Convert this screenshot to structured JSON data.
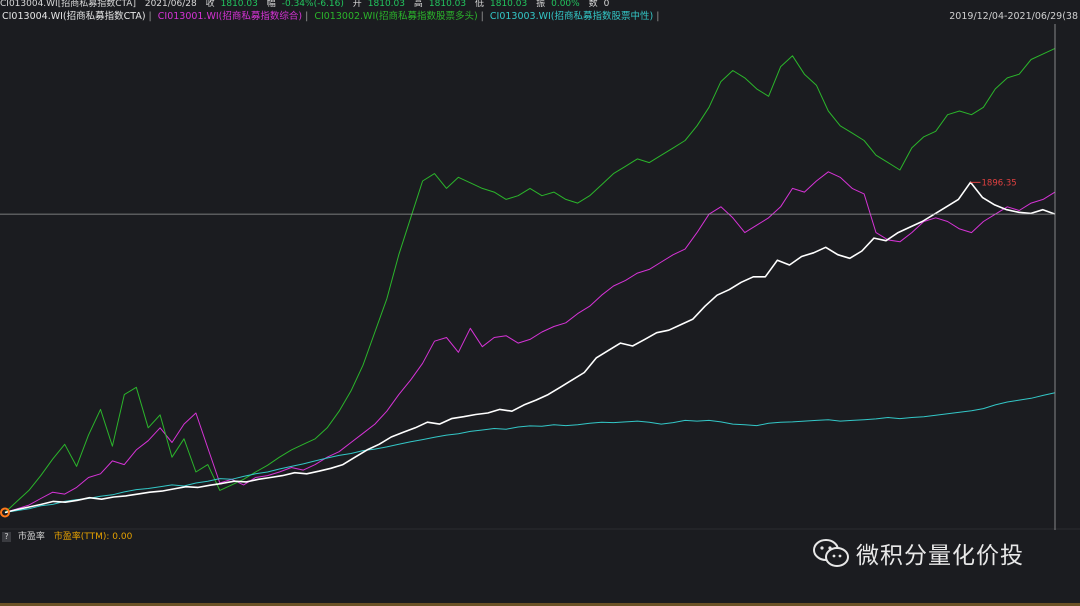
{
  "header": {
    "code": "CI013004.WI[招商私募指数CTA]",
    "date": "2021/06/28",
    "close_label": "收",
    "close": "1810.03",
    "change_label": "幅",
    "change": "-0.34%(-6.16)",
    "open_label": "开",
    "open": "1810.03",
    "high_label": "高",
    "high": "1810.03",
    "low_label": "低",
    "low": "1810.03",
    "amp_label": "振",
    "amp": "0.00%",
    "vol_label": "数",
    "vol": "0"
  },
  "legend": {
    "items": [
      {
        "label": "CI013004.WI(招商私募指数CTA)",
        "color": "#e6e6e6"
      },
      {
        "label": "CI013001.WI(招商私募指数综合)",
        "color": "#d633d6"
      },
      {
        "label": "CI013002.WI(招商私募指数股票多头)",
        "color": "#2bb52b"
      },
      {
        "label": "CI013003.WI(招商私募指数股票中性)",
        "color": "#33c7c7"
      }
    ]
  },
  "date_range": "2019/12/04-2021/06/29(38",
  "subpanel": {
    "question": "?",
    "name": "市盈率",
    "value": "市盈率(TTM): 0.00"
  },
  "watermark": "微积分量化价投",
  "chart_data": {
    "type": "line",
    "x_start": "2019/12/04",
    "x_end": "2021/06/29",
    "max_marker_label": "1896.35",
    "series": [
      {
        "name": "CI013004.WI(招商私募指数CTA)",
        "color": "#ffffff",
        "values": [
          1000,
          1008,
          1015,
          1022,
          1030,
          1028,
          1033,
          1040,
          1036,
          1042,
          1045,
          1050,
          1055,
          1058,
          1064,
          1070,
          1068,
          1074,
          1079,
          1085,
          1083,
          1090,
          1095,
          1100,
          1108,
          1105,
          1112,
          1120,
          1130,
          1150,
          1170,
          1185,
          1205,
          1218,
          1230,
          1245,
          1240,
          1255,
          1260,
          1266,
          1270,
          1280,
          1275,
          1292,
          1305,
          1320,
          1340,
          1360,
          1380,
          1420,
          1440,
          1460,
          1452,
          1470,
          1488,
          1495,
          1510,
          1525,
          1560,
          1590,
          1605,
          1625,
          1640,
          1640,
          1685,
          1672,
          1695,
          1705,
          1720,
          1700,
          1690,
          1710,
          1745,
          1738,
          1760,
          1775,
          1790,
          1810,
          1830,
          1850,
          1896.35,
          1855,
          1835,
          1822,
          1815,
          1812,
          1822,
          1810.03
        ]
      },
      {
        "name": "CI013001.WI(招商私募指数综合)",
        "color": "#d633d6",
        "values": [
          1000,
          1010,
          1020,
          1038,
          1055,
          1050,
          1068,
          1095,
          1105,
          1140,
          1130,
          1170,
          1195,
          1230,
          1190,
          1240,
          1270,
          1175,
          1080,
          1090,
          1075,
          1095,
          1100,
          1110,
          1122,
          1115,
          1130,
          1150,
          1165,
          1190,
          1215,
          1240,
          1275,
          1320,
          1360,
          1405,
          1465,
          1475,
          1435,
          1500,
          1450,
          1475,
          1480,
          1460,
          1470,
          1490,
          1505,
          1515,
          1540,
          1560,
          1590,
          1615,
          1630,
          1650,
          1660,
          1680,
          1700,
          1715,
          1760,
          1810,
          1830,
          1800,
          1760,
          1780,
          1800,
          1830,
          1880,
          1870,
          1900,
          1925,
          1910,
          1880,
          1865,
          1760,
          1740,
          1735,
          1760,
          1790,
          1800,
          1790,
          1770,
          1760,
          1790,
          1810,
          1830,
          1820,
          1840,
          1850,
          1870
        ]
      },
      {
        "name": "CI013002.WI(招商私募指数股票多头)",
        "color": "#2bb52b",
        "values": [
          1000,
          1030,
          1060,
          1100,
          1145,
          1185,
          1125,
          1210,
          1280,
          1180,
          1320,
          1340,
          1230,
          1265,
          1150,
          1200,
          1110,
          1130,
          1060,
          1075,
          1090,
          1110,
          1128,
          1150,
          1170,
          1185,
          1200,
          1230,
          1275,
          1330,
          1400,
          1490,
          1580,
          1700,
          1800,
          1900,
          1920,
          1880,
          1910,
          1895,
          1880,
          1870,
          1850,
          1860,
          1880,
          1860,
          1870,
          1850,
          1840,
          1860,
          1890,
          1920,
          1940,
          1960,
          1950,
          1970,
          1990,
          2010,
          2050,
          2100,
          2170,
          2200,
          2180,
          2150,
          2130,
          2210,
          2240,
          2190,
          2160,
          2090,
          2050,
          2030,
          2010,
          1970,
          1950,
          1930,
          1990,
          2020,
          2035,
          2080,
          2090,
          2080,
          2100,
          2150,
          2180,
          2190,
          2230,
          2245,
          2260
        ]
      },
      {
        "name": "CI013003.WI(招商私募指数股票中性)",
        "color": "#33c7c7",
        "values": [
          1000,
          1005,
          1010,
          1018,
          1022,
          1030,
          1035,
          1038,
          1044,
          1048,
          1056,
          1062,
          1065,
          1070,
          1075,
          1072,
          1080,
          1085,
          1092,
          1090,
          1098,
          1105,
          1110,
          1118,
          1125,
          1132,
          1140,
          1148,
          1155,
          1160,
          1168,
          1172,
          1178,
          1185,
          1192,
          1198,
          1204,
          1210,
          1214,
          1220,
          1224,
          1228,
          1226,
          1232,
          1235,
          1234,
          1238,
          1236,
          1238,
          1242,
          1245,
          1244,
          1246,
          1248,
          1245,
          1240,
          1244,
          1250,
          1248,
          1250,
          1246,
          1240,
          1238,
          1236,
          1242,
          1245,
          1246,
          1248,
          1250,
          1252,
          1248,
          1250,
          1252,
          1254,
          1258,
          1255,
          1258,
          1260,
          1264,
          1268,
          1272,
          1276,
          1282,
          1292,
          1300,
          1305,
          1310,
          1318,
          1325
        ]
      }
    ],
    "ylim": [
      985,
      2310
    ],
    "grid": true,
    "legend_position": "top-left",
    "crosshair_value": 1810.03
  }
}
